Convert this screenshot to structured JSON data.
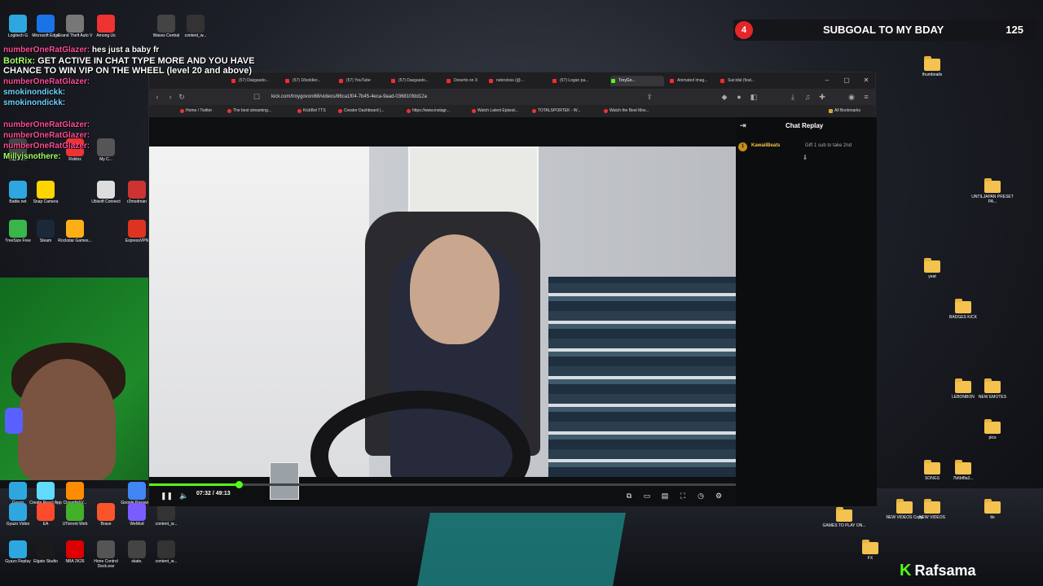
{
  "overlay": {
    "subgoal": {
      "badge": "4",
      "label": "SUBGOAL TO MY BDAY",
      "count": "125"
    },
    "chat": [
      {
        "user": "numberOneRatGlazer:",
        "msg": "hes just a baby fr"
      },
      {
        "user": "BotRix:",
        "msg": "GET ACTIVE IN CHAT TYPE MORE AND YOU HAVE CHANCE TO WIN VIP ON THE WHEEL (level 20 and above)"
      },
      {
        "user": "numberOneRatGlazer:",
        "msg": ""
      },
      {
        "user": "smokinondickk:",
        "msg": ""
      },
      {
        "user": "smokinondickk:",
        "msg": ""
      },
      {
        "user": "numberOneRatGlazer:",
        "msg": ""
      },
      {
        "user": "numberOneRatGlazer:",
        "msg": ""
      },
      {
        "user": "numberOneRatGlazer:",
        "msg": ""
      },
      {
        "user": "Millyisnothere:",
        "msg": ""
      }
    ],
    "brand": "Rafsama",
    "brand_mark": "K"
  },
  "desktop_icons_left": [
    "Logitech G",
    "Microsoft Edge",
    "Grand Theft Auto V",
    "Among Us",
    "Waves Central",
    "content_w...",
    "Capture...",
    "Roblox",
    "My C...",
    "Battle.net",
    "Snap Camera",
    "Ubisoft Connect",
    "r2modman",
    "TreeSize Free",
    "Steam",
    "Rockstar Games...",
    "ExpressVPN",
    "Gyazo",
    "Create React App Sample",
    "ClownfishV...",
    "Google Passwo...",
    "Gyazo Video",
    "EA",
    "UTorrent Web",
    "Brave",
    "WeMod",
    "content_w...",
    "Gyazo Replay",
    "Elgato Studio",
    "NBA 2K26",
    "Hone Control Deck.exe",
    "skate.",
    "content_w..."
  ],
  "desktop_folders_right": [
    "thumbnails",
    "UNTILJAPAN PRESET PA...",
    "yeat",
    "BADGES KICK",
    "LEBONBON",
    "NEW EMOTES",
    "pics",
    "SONGS",
    "7b6bf8a3...",
    "GAMES TO PLAY ON...",
    "NEW VIDEOS Copy",
    "NEW VIDEOS",
    "tts",
    "FX"
  ],
  "browser": {
    "tabs": [
      "(57) Dasgasdo...",
      "(57) 18soldier...",
      "(57) YouTube",
      "(57) Dasgasdo...",
      "Deserto on X",
      "nebroloss (@...",
      "(57) Logan pa...",
      "TroyGo...",
      "Animated imag...",
      "Suicidal (feat..."
    ],
    "active_tab": 7,
    "url": "kick.com/troygovoni68/videos/86ca1f04-7b45-4eca-9aad-036810fdd12a",
    "bookmarks": [
      "Home / Twitter",
      "The best streaming...",
      "KickBot TTS",
      "Creator Dashboard |...",
      "https://www.instagr...",
      "Watch Latest Episod...",
      "TOTALSPORTEK - W...",
      "Watch the Best Mov..."
    ],
    "all_bookmarks": "All Bookmarks"
  },
  "player": {
    "time": "07:32 / 49:13",
    "progress": 0.153
  },
  "chat_replay": {
    "title": "Chat Replay",
    "messages": [
      {
        "badge": "1",
        "user": "KawaiiBeats",
        "text": "Gift 1 sub to take 2nd"
      }
    ]
  },
  "colors": {
    "kick_green": "#53fc18",
    "goal_red": "#e4262b"
  }
}
